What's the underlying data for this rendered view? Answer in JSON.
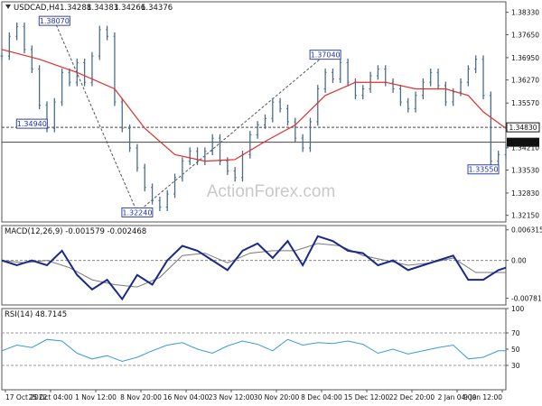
{
  "chart_data": [
    {
      "type": "line",
      "panel": "price",
      "title": "USDCAD,H4",
      "ohlc": {
        "open": "1.34288",
        "high": "1.34383",
        "low": "1.34266",
        "close": "1.34376"
      },
      "y_ticks": [
        "1.38330",
        "1.37650",
        "1.36950",
        "1.36270",
        "1.35570",
        "1.34890",
        "1.34210",
        "1.33530",
        "1.32830",
        "1.32150"
      ],
      "ylim": [
        1.3195,
        1.3865
      ],
      "x_ticks": [
        "17 Oct 2022",
        "25 Oct 04:00",
        "1 Nov 12:00",
        "8 Nov 20:00",
        "16 Nov 04:00",
        "23 Nov 12:00",
        "30 Nov 20:00",
        "8 Dec 04:00",
        "15 Dec 12:00",
        "22 Dec 20:00",
        "2 Jan 04:00",
        "9 Jan 12:00"
      ],
      "levels": [
        {
          "name": "resistance",
          "value": 1.3483,
          "label": "1.34830",
          "style": "dashed"
        },
        {
          "name": "current",
          "value": 1.34376,
          "label": "1.34376",
          "style": "solid"
        }
      ],
      "annotations": [
        {
          "label": "1.38070",
          "x": 14,
          "y": 1.3807
        },
        {
          "label": "1.34940",
          "x": 8,
          "y": 1.3494
        },
        {
          "label": "1.32240",
          "x": 36,
          "y": 1.3224
        },
        {
          "label": "1.37040",
          "x": 86,
          "y": 1.3704
        },
        {
          "label": "1.33550",
          "x": 128,
          "y": 1.3355
        }
      ],
      "trendlines": [
        {
          "from": [
            14,
            1.3807
          ],
          "to": [
            36,
            1.3224
          ]
        },
        {
          "from": [
            36,
            1.3224
          ],
          "to": [
            86,
            1.3704
          ]
        }
      ],
      "series": [
        {
          "style": "bars",
          "color": "#4a6e8a",
          "x": [
            0,
            2,
            4,
            6,
            8,
            10,
            12,
            14,
            16,
            18,
            20,
            22,
            24,
            26,
            28,
            30,
            32,
            34,
            36,
            38,
            40,
            42,
            44,
            46,
            48,
            50,
            52,
            54,
            56,
            58,
            60,
            62,
            64,
            66,
            68,
            70,
            72,
            74,
            76,
            78,
            80,
            82,
            84,
            86,
            88,
            90,
            92,
            94,
            96,
            98,
            100,
            102,
            104,
            106,
            108,
            110,
            112,
            114,
            116,
            118,
            120,
            122,
            124,
            126,
            128,
            130,
            132,
            134
          ],
          "y": [
            1.37,
            1.376,
            1.379,
            1.372,
            1.366,
            1.355,
            1.348,
            1.356,
            1.365,
            1.362,
            1.368,
            1.362,
            1.37,
            1.378,
            1.376,
            1.356,
            1.348,
            1.342,
            1.336,
            1.33,
            1.326,
            1.324,
            1.328,
            1.333,
            1.338,
            1.341,
            1.338,
            1.341,
            1.345,
            1.338,
            1.335,
            1.333,
            1.34,
            1.346,
            1.349,
            1.351,
            1.356,
            1.354,
            1.35,
            1.345,
            1.342,
            1.35,
            1.36,
            1.365,
            1.363,
            1.368,
            1.362,
            1.358,
            1.36,
            1.364,
            1.366,
            1.362,
            1.36,
            1.356,
            1.354,
            1.358,
            1.362,
            1.365,
            1.361,
            1.356,
            1.359,
            1.362,
            1.366,
            1.369,
            1.358,
            1.338,
            1.34,
            1.342
          ]
        },
        {
          "style": "ma",
          "color": "#e0302a",
          "x": [
            0,
            10,
            20,
            30,
            38,
            46,
            54,
            62,
            70,
            78,
            86,
            94,
            102,
            110,
            118,
            124,
            128,
            134
          ],
          "y": [
            1.372,
            1.369,
            1.365,
            1.36,
            1.348,
            1.34,
            1.338,
            1.3385,
            1.344,
            1.349,
            1.358,
            1.362,
            1.362,
            1.36,
            1.36,
            1.358,
            1.353,
            1.348
          ]
        }
      ]
    },
    {
      "type": "line",
      "panel": "macd",
      "title": "MACD(12,26,9) -0.001579 -0.002468",
      "y_ticks": [
        "0.006315",
        "0.00",
        "-0.007818"
      ],
      "ylim": [
        -0.0092,
        0.0072
      ],
      "series": [
        {
          "style": "main",
          "color": "#1a2a8a",
          "x": [
            0,
            4,
            8,
            12,
            16,
            20,
            24,
            28,
            32,
            36,
            40,
            44,
            48,
            52,
            56,
            60,
            64,
            68,
            72,
            76,
            80,
            84,
            88,
            92,
            96,
            100,
            104,
            108,
            112,
            116,
            120,
            124,
            128,
            132,
            134
          ],
          "y": [
            0.0,
            -0.001,
            0.0,
            -0.001,
            0.002,
            -0.003,
            -0.006,
            -0.004,
            -0.008,
            -0.003,
            -0.005,
            0.0,
            0.003,
            0.002,
            0.0,
            -0.002,
            0.002,
            0.0035,
            0.0005,
            0.004,
            -0.001,
            0.005,
            0.004,
            0.002,
            0.0015,
            -0.001,
            0.0,
            -0.002,
            -0.001,
            0.0,
            0.001,
            -0.004,
            -0.004,
            -0.002,
            -0.0015
          ]
        },
        {
          "style": "signal",
          "color": "#7a7a7a",
          "x": [
            0,
            6,
            12,
            18,
            24,
            30,
            36,
            42,
            48,
            54,
            60,
            66,
            72,
            78,
            84,
            90,
            96,
            102,
            108,
            114,
            120,
            126,
            134
          ],
          "y": [
            0.0,
            -0.0005,
            0.0,
            -0.0015,
            -0.004,
            -0.005,
            -0.0055,
            -0.0035,
            0.001,
            0.0015,
            -0.0005,
            0.0015,
            0.002,
            0.002,
            0.0035,
            0.003,
            0.001,
            0.0,
            -0.001,
            -0.0005,
            0.0005,
            -0.0025,
            -0.0025
          ]
        }
      ]
    },
    {
      "type": "line",
      "panel": "rsi",
      "title": "RSI(14) 48.7145",
      "y_ticks": [
        "100",
        "70",
        "50",
        "30",
        "0"
      ],
      "ylim": [
        0,
        100
      ],
      "levels": [
        70,
        30
      ],
      "series": [
        {
          "style": "main",
          "color": "#3a9ad9",
          "x": [
            0,
            4,
            8,
            12,
            16,
            20,
            24,
            28,
            32,
            36,
            40,
            44,
            48,
            52,
            56,
            60,
            64,
            68,
            72,
            76,
            80,
            84,
            88,
            92,
            96,
            100,
            104,
            108,
            112,
            116,
            120,
            124,
            128,
            132,
            134
          ],
          "y": [
            48,
            55,
            52,
            62,
            60,
            45,
            38,
            42,
            35,
            40,
            48,
            55,
            58,
            50,
            45,
            54,
            60,
            56,
            48,
            62,
            55,
            58,
            57,
            60,
            56,
            45,
            50,
            44,
            48,
            52,
            55,
            38,
            40,
            48,
            48
          ]
        }
      ]
    }
  ],
  "watermark": "ActionForex.com"
}
